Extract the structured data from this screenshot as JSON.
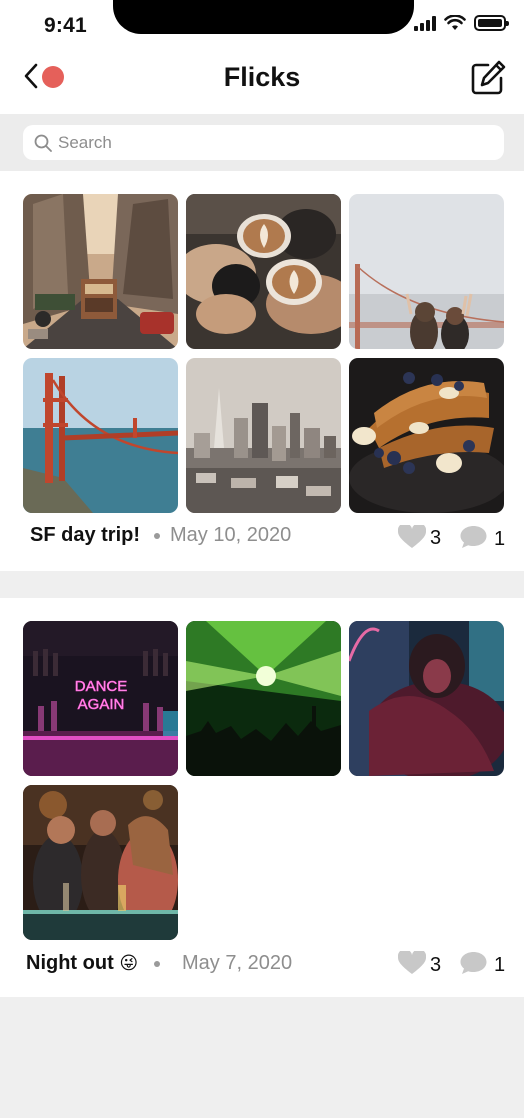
{
  "status_bar": {
    "time": "9:41"
  },
  "header": {
    "title": "Flicks"
  },
  "search": {
    "placeholder": "Search"
  },
  "albums": [
    {
      "title": "SF day trip!",
      "date": "May 10, 2020",
      "likes": "3",
      "comments": "1",
      "photos": [
        "cable-car-street",
        "coffee-cheers",
        "golden-gate-friends",
        "golden-gate-bridge",
        "sf-skyline",
        "french-toast"
      ]
    },
    {
      "title": "Night out",
      "emoji": "😜",
      "date": "May 7, 2020",
      "likes": "3",
      "comments": "1",
      "photos": [
        "dance-again-neon",
        "green-lasers-crowd",
        "dancer-red-light",
        "bar-friends"
      ]
    }
  ],
  "neon_sign": {
    "line1": "DANCE",
    "line2": "AGAIN"
  },
  "colors": {
    "accent_dot": "#e5605a",
    "heart": "#c8c8c8",
    "comment": "#c8c8c8"
  },
  "icons": [
    "chevron-left-icon",
    "compose-icon",
    "search-icon",
    "heart-icon",
    "comment-icon",
    "signal-icon",
    "wifi-icon",
    "battery-icon"
  ]
}
